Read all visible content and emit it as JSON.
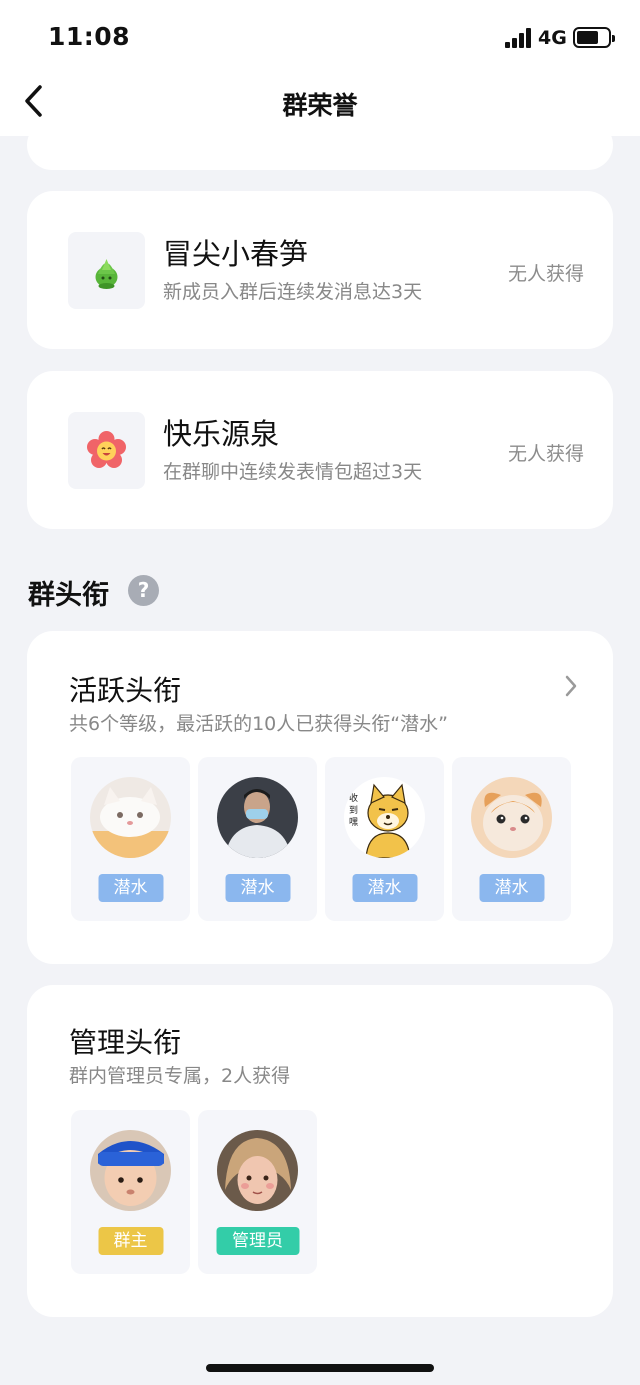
{
  "status_bar": {
    "time": "11:08",
    "network": "4G"
  },
  "nav": {
    "title": "群荣誉"
  },
  "honors": [
    {
      "name": "冒尖小春笋",
      "description": "新成员入群后连续发消息达3天",
      "status": "无人获得",
      "icon": "bamboo-shoot-icon"
    },
    {
      "name": "快乐源泉",
      "description": "在群聊中连续发表情包超过3天",
      "status": "无人获得",
      "icon": "happy-flower-icon"
    }
  ],
  "titles_section": {
    "heading": "群头衔",
    "help_icon": "question-icon"
  },
  "active_titles": {
    "title": "活跃头衔",
    "subtitle": "共6个等级，最活跃的10人已获得头衔“潜水”",
    "members": [
      {
        "avatar": "white-cat-avatar",
        "badge": "潜水"
      },
      {
        "avatar": "masked-man-avatar",
        "badge": "潜水"
      },
      {
        "avatar": "shiba-dog-sticker-avatar",
        "badge": "潜水",
        "sticker_text": "收到 嘿"
      },
      {
        "avatar": "orange-cat-avatar",
        "badge": "潜水"
      }
    ]
  },
  "admin_titles": {
    "title": "管理头衔",
    "subtitle": "群内管理员专属，2人获得",
    "members": [
      {
        "avatar": "baby-headband-avatar",
        "badge": "群主"
      },
      {
        "avatar": "child-photo-avatar",
        "badge": "管理员"
      }
    ]
  },
  "colors": {
    "background": "#f2f3f7",
    "card": "#ffffff",
    "badge_dive": "#8bb7ee",
    "badge_owner": "#ecc647",
    "badge_admin": "#33cda8"
  }
}
